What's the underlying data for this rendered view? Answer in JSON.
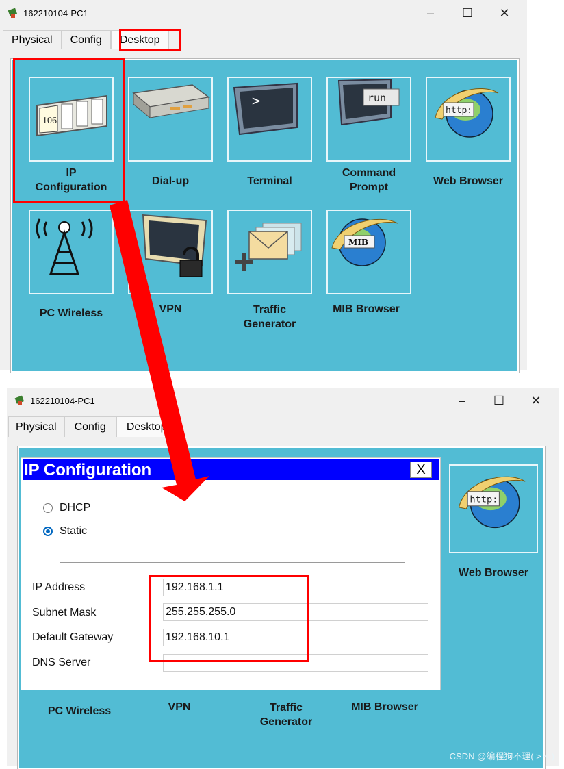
{
  "top_window": {
    "title": "162210104-PC1",
    "tabs": [
      "Physical",
      "Config",
      "Desktop"
    ],
    "apps": [
      {
        "label": "IP\nConfiguration",
        "icon": "ip-configuration-icon",
        "icon_text": "106"
      },
      {
        "label": "Dial-up",
        "icon": "modem-icon"
      },
      {
        "label": "Terminal",
        "icon": "terminal-icon",
        "icon_text": ">"
      },
      {
        "label": "Command\nPrompt",
        "icon": "command-prompt-icon",
        "icon_text": "run"
      },
      {
        "label": "Web Browser",
        "icon": "web-browser-icon",
        "icon_text": "http:"
      },
      {
        "label": "PC Wireless",
        "icon": "wireless-antenna-icon"
      },
      {
        "label": "VPN",
        "icon": "vpn-lock-icon"
      },
      {
        "label": "Traffic\nGenerator",
        "icon": "traffic-generator-icon"
      },
      {
        "label": "MIB Browser",
        "icon": "mib-browser-icon",
        "icon_text": "MIB"
      }
    ]
  },
  "bottom_window": {
    "title": "162210104-PC1",
    "tabs": [
      "Physical",
      "Config",
      "Desktop"
    ],
    "visible_apps": [
      {
        "label": "Web Browser",
        "icon": "web-browser-icon",
        "icon_text": "http:"
      },
      {
        "label": "PC Wireless"
      },
      {
        "label": "VPN"
      },
      {
        "label": "Traffic\nGenerator"
      },
      {
        "label": "MIB Browser"
      }
    ],
    "ip_dialog": {
      "title": "IP Configuration",
      "close_label": "X",
      "modes": [
        {
          "label": "DHCP",
          "selected": false
        },
        {
          "label": "Static",
          "selected": true
        }
      ],
      "fields": [
        {
          "label": "IP Address",
          "value": "192.168.1.1"
        },
        {
          "label": "Subnet Mask",
          "value": "255.255.255.0"
        },
        {
          "label": "Default Gateway",
          "value": "192.168.10.1"
        },
        {
          "label": "DNS Server",
          "value": ""
        }
      ]
    }
  },
  "watermark": "CSDN @编程狗不理( > < )",
  "colors": {
    "desktop_bg": "#52bcd4",
    "highlight": "#ff0000",
    "dialog_header": "#0000ff",
    "radio_selected": "#0067c0"
  }
}
